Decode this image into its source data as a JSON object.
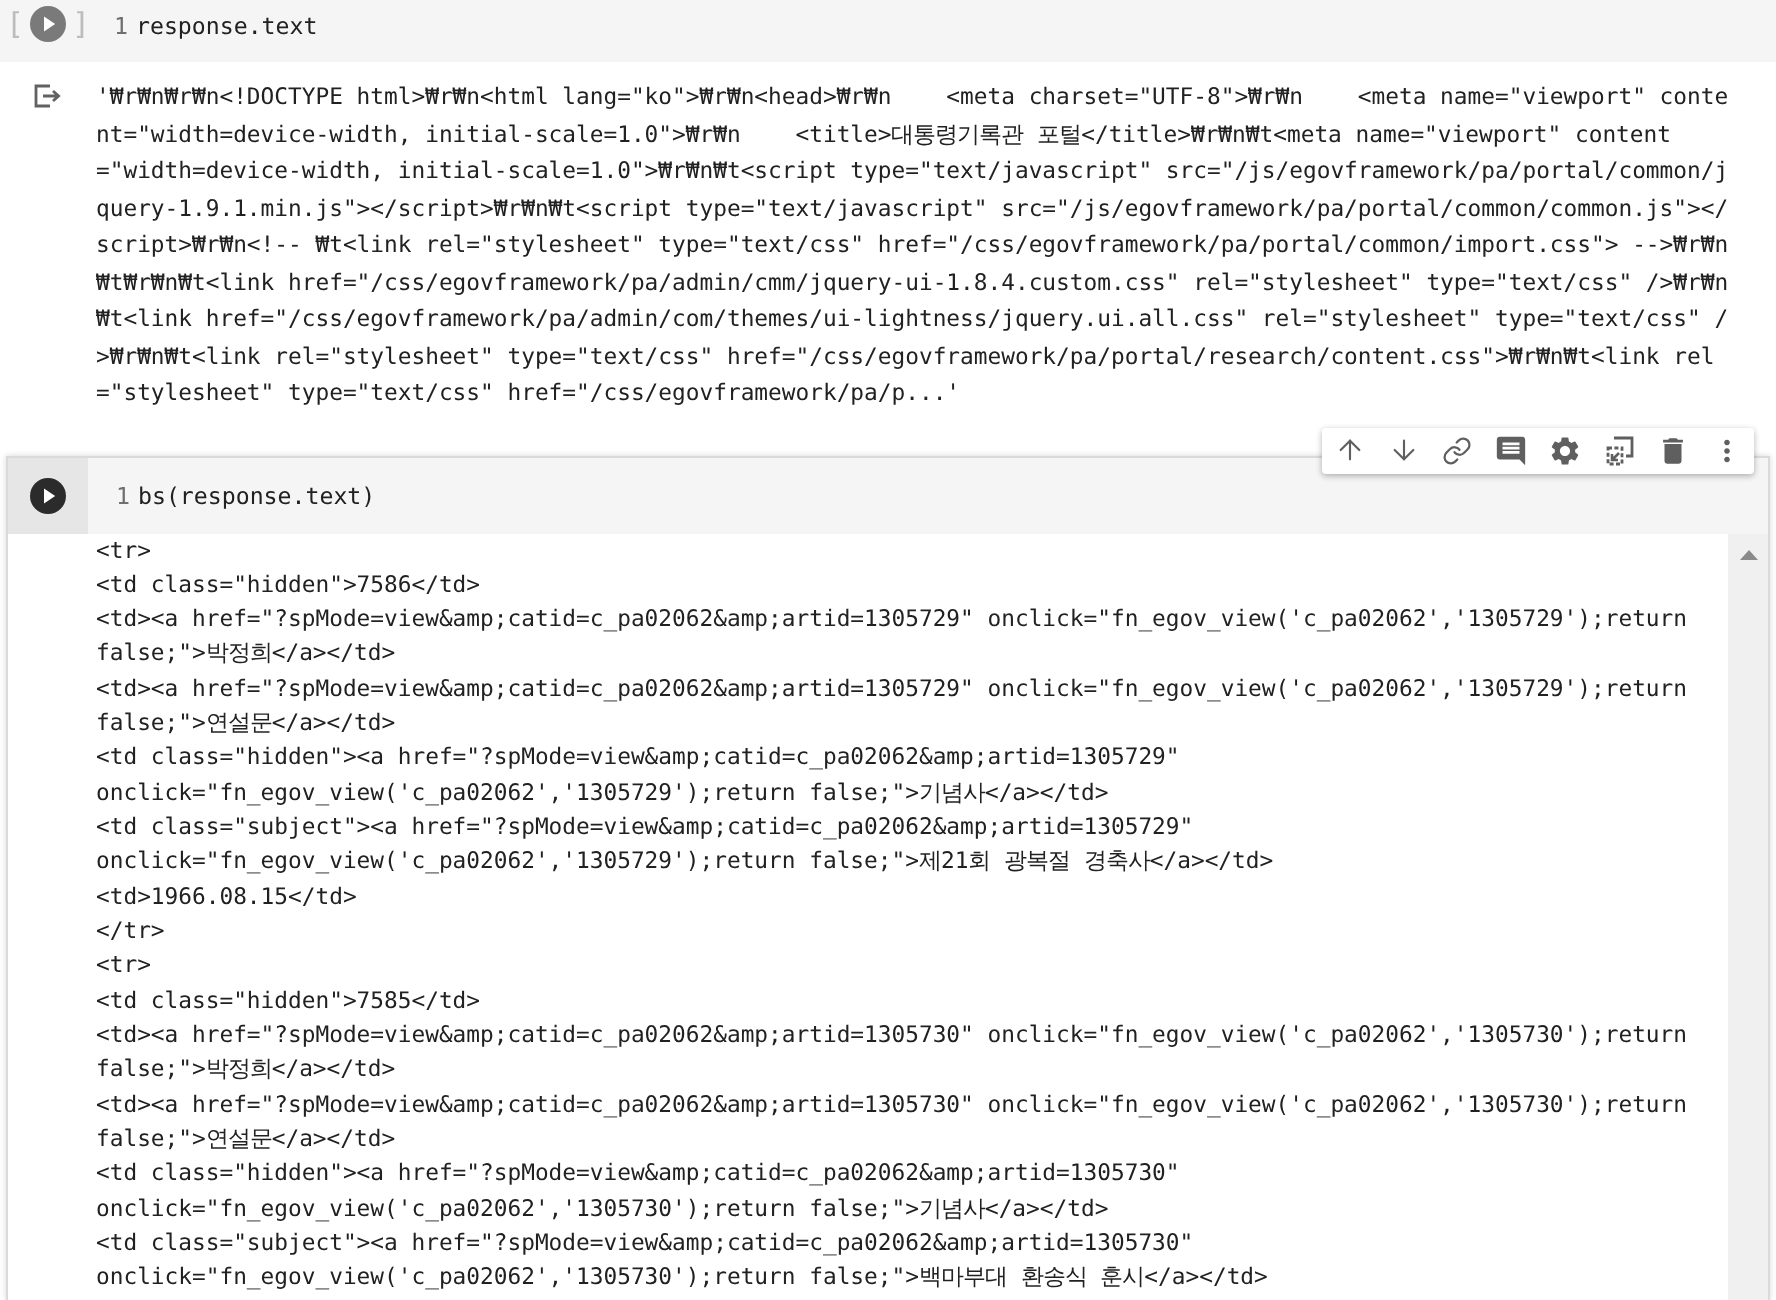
{
  "cells": [
    {
      "kind": "code",
      "selected": false,
      "prompt": [
        "[",
        "]"
      ],
      "lines": [
        {
          "number": "1",
          "code": "response.text"
        }
      ],
      "output": {
        "kind": "plain",
        "lines": [
          "'₩r₩n₩r₩n<!DOCTYPE html>₩r₩n<html lang=\"ko\">₩r₩n<head>₩r₩n    <meta charset=\"UTF-8\">₩r₩n    <meta name=\"viewport\" conte",
          "nt=\"width=device-width, initial-scale=1.0\">₩r₩n    <title>대통령기록관 포털</title>₩r₩n₩t<meta name=\"viewport\" content",
          "=\"width=device-width, initial-scale=1.0\">₩r₩n₩t<script type=\"text/javascript\" src=\"/js/egovframework/pa/portal/common/j",
          "query-1.9.1.min.js\"></script>₩r₩n₩t<script type=\"text/javascript\" src=\"/js/egovframework/pa/portal/common/common.js\"></",
          "script>₩r₩n<!-- ₩t<link rel=\"stylesheet\" type=\"text/css\" href=\"/css/egovframework/pa/portal/common/import.css\"> -->₩r₩n",
          "₩t₩r₩n₩t<link href=\"/css/egovframework/pa/admin/cmm/jquery-ui-1.8.4.custom.css\" rel=\"stylesheet\" type=\"text/css\" />₩r₩n",
          "₩t<link href=\"/css/egovframework/pa/admin/com/themes/ui-lightness/jquery.ui.all.css\" rel=\"stylesheet\" type=\"text/css\" /",
          ">₩r₩n₩t<link rel=\"stylesheet\" type=\"text/css\" href=\"/css/egovframework/pa/portal/research/content.css\">₩r₩n₩t<link rel",
          "=\"stylesheet\" type=\"text/css\" href=\"/css/egovframework/pa/p...'"
        ]
      }
    },
    {
      "kind": "code",
      "selected": true,
      "lines": [
        {
          "number": "1",
          "code": "bs(response.text)"
        }
      ],
      "output": {
        "kind": "scrolling",
        "lines": [
          "<tr>",
          "<td class=\"hidden\">7586</td>",
          "<td><a href=\"?spMode=view&amp;catid=c_pa02062&amp;artid=1305729\" onclick=\"fn_egov_view('c_pa02062','1305729');return",
          "false;\">박정희</a></td>",
          "<td><a href=\"?spMode=view&amp;catid=c_pa02062&amp;artid=1305729\" onclick=\"fn_egov_view('c_pa02062','1305729');return",
          "false;\">연설문</a></td>",
          "<td class=\"hidden\"><a href=\"?spMode=view&amp;catid=c_pa02062&amp;artid=1305729\"",
          "onclick=\"fn_egov_view('c_pa02062','1305729');return false;\">기념사</a></td>",
          "<td class=\"subject\"><a href=\"?spMode=view&amp;catid=c_pa02062&amp;artid=1305729\"",
          "onclick=\"fn_egov_view('c_pa02062','1305729');return false;\">제21회 광복절 경축사</a></td>",
          "<td>1966.08.15</td>",
          "</tr>",
          "<tr>",
          "<td class=\"hidden\">7585</td>",
          "<td><a href=\"?spMode=view&amp;catid=c_pa02062&amp;artid=1305730\" onclick=\"fn_egov_view('c_pa02062','1305730');return",
          "false;\">박정희</a></td>",
          "<td><a href=\"?spMode=view&amp;catid=c_pa02062&amp;artid=1305730\" onclick=\"fn_egov_view('c_pa02062','1305730');return",
          "false;\">연설문</a></td>",
          "<td class=\"hidden\"><a href=\"?spMode=view&amp;catid=c_pa02062&amp;artid=1305730\"",
          "onclick=\"fn_egov_view('c_pa02062','1305730');return false;\">기념사</a></td>",
          "<td class=\"subject\"><a href=\"?spMode=view&amp;catid=c_pa02062&amp;artid=1305730\"",
          "onclick=\"fn_egov_view('c_pa02062','1305730');return false;\">백마부대 환송식 훈시</a></td>"
        ]
      }
    }
  ]
}
